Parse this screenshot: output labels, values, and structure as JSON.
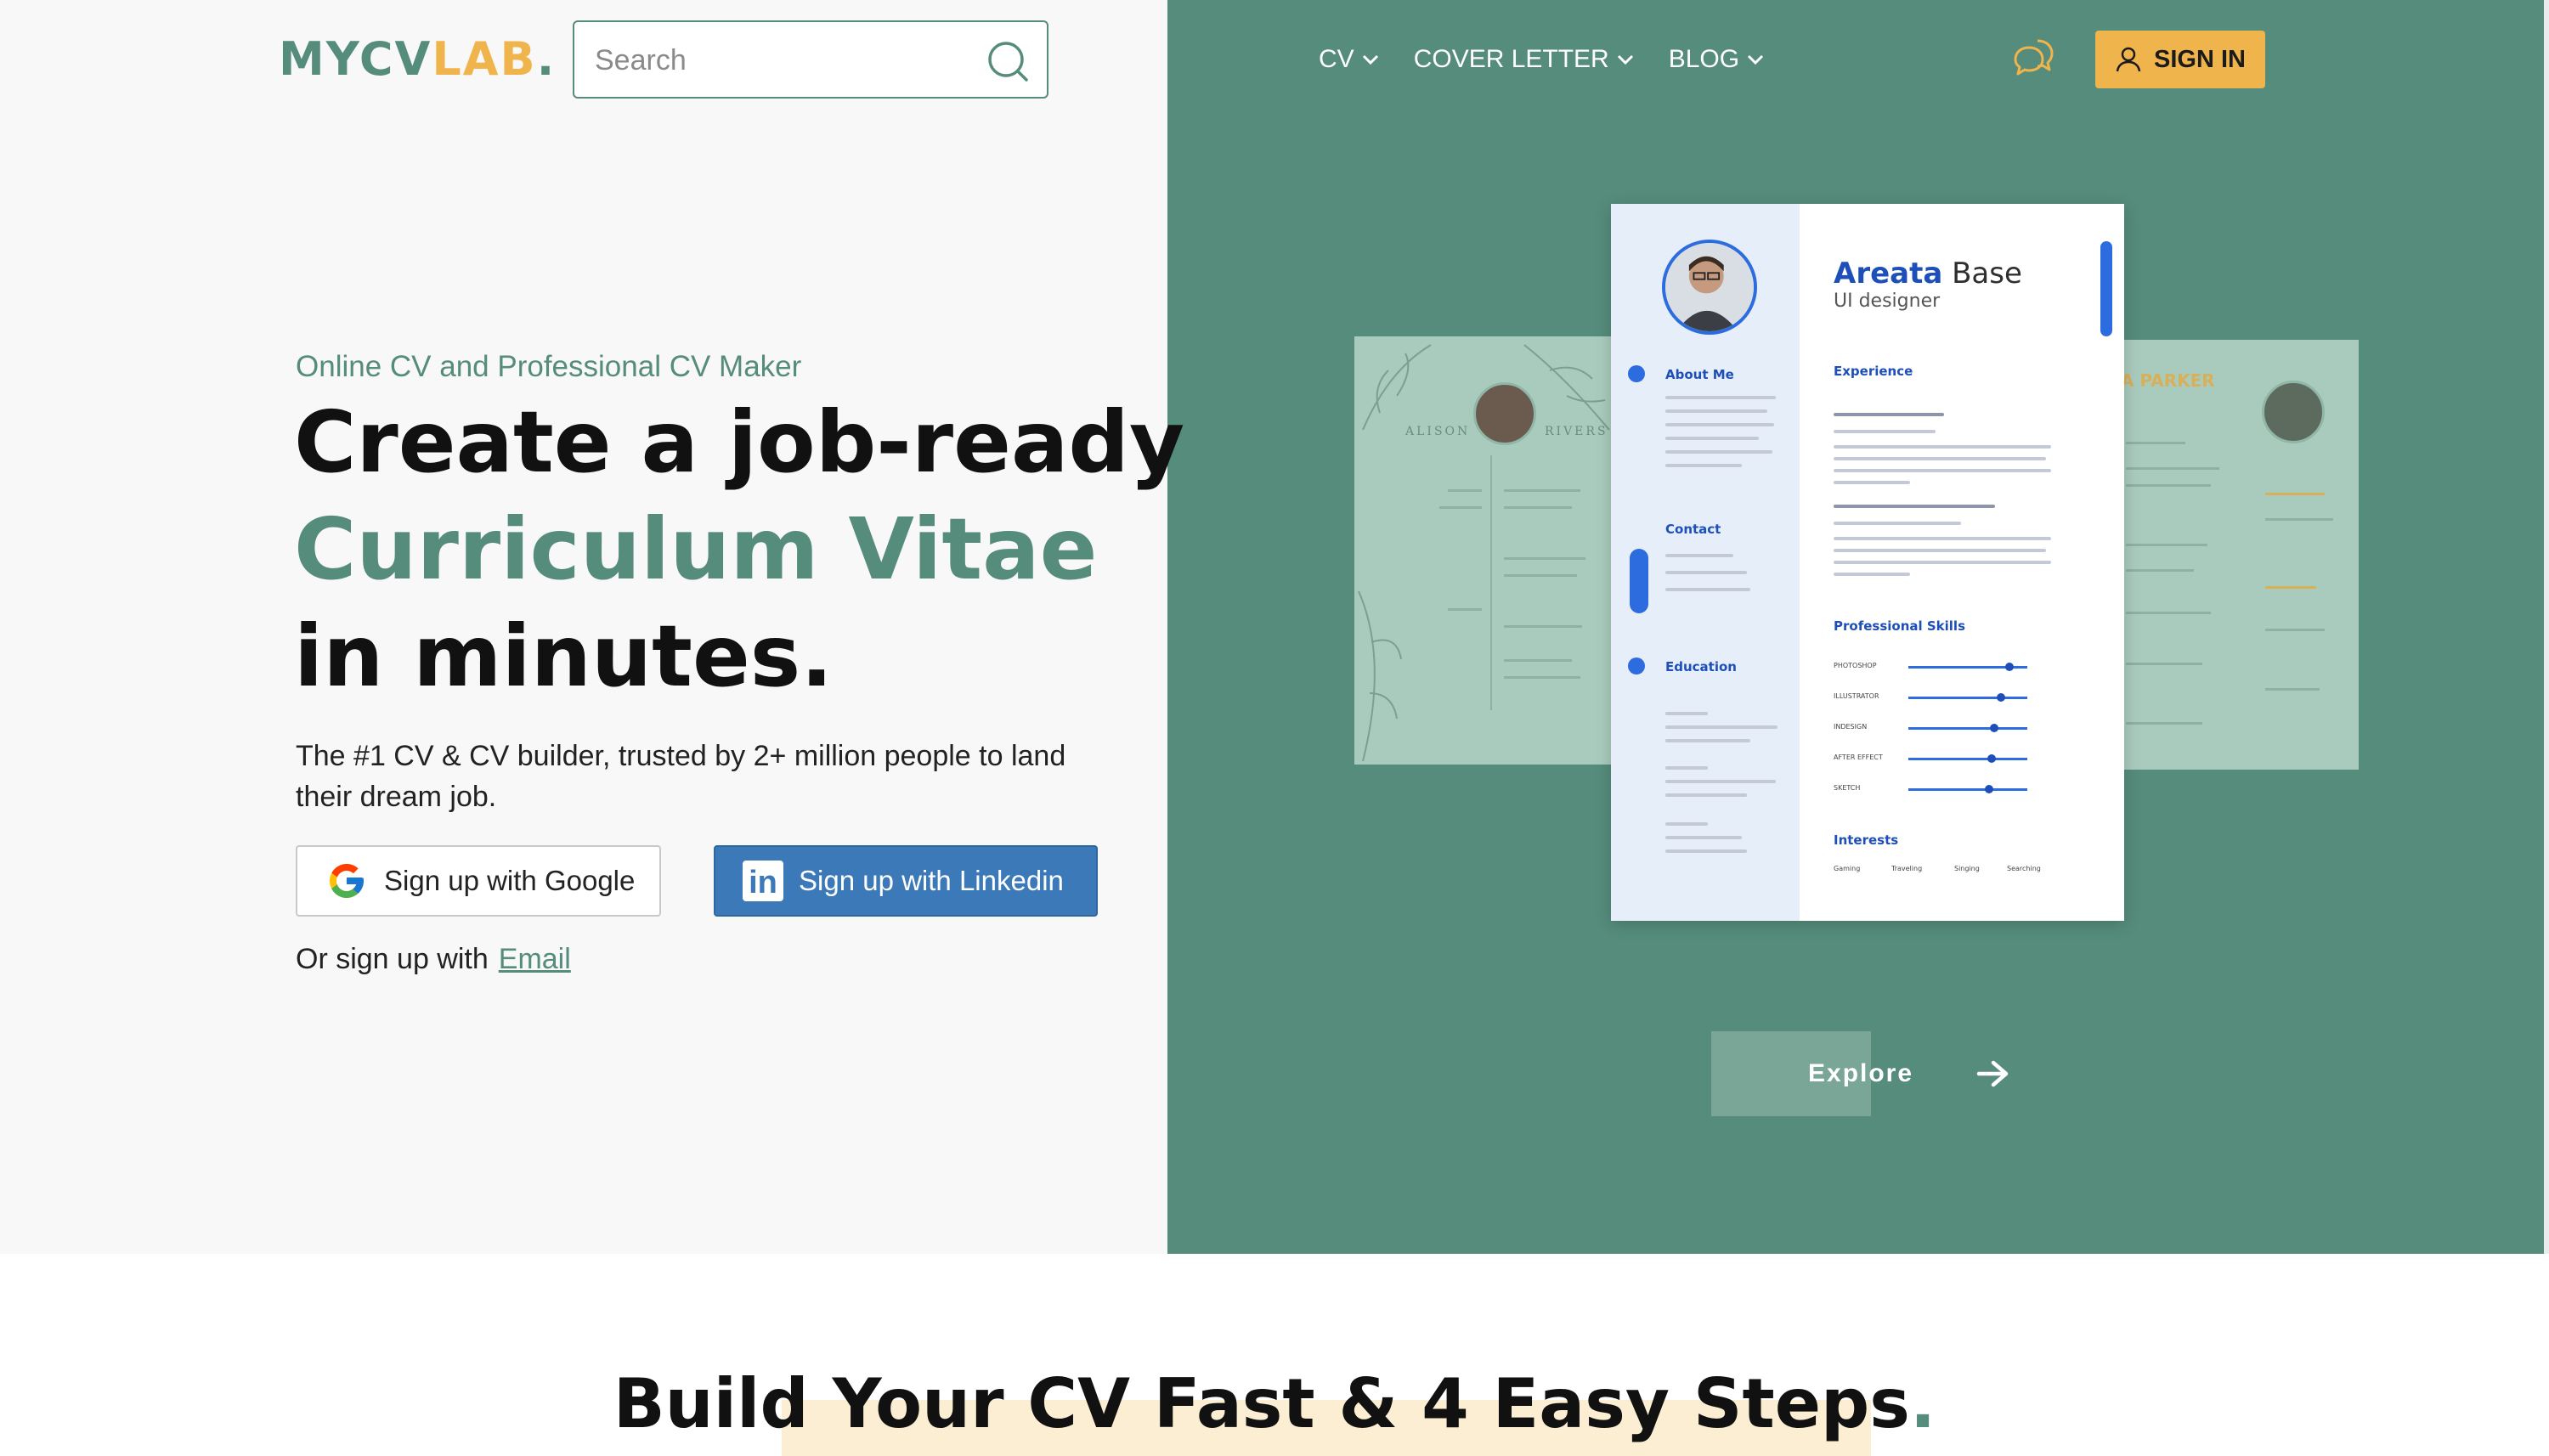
{
  "brand": {
    "logo_part1": "MYCV",
    "logo_part2": "LAB",
    "logo_part3": ".",
    "primary_color": "#558c7b",
    "accent_color": "#f0b44c"
  },
  "search": {
    "placeholder": "Search",
    "icon": "search-icon"
  },
  "nav": {
    "items": [
      {
        "label": "CV",
        "icon": "chevron-down-icon"
      },
      {
        "label": "COVER LETTER",
        "icon": "chevron-down-icon"
      },
      {
        "label": "BLOG",
        "icon": "chevron-down-icon"
      }
    ],
    "chat_icon": "chat-bubbles-icon",
    "signin_label": "SIGN IN",
    "signin_icon": "user-icon"
  },
  "hero": {
    "eyebrow": "Online CV and Professional CV Maker",
    "headline_line1": "Create a job-ready",
    "headline_line2": "Curriculum Vitae",
    "headline_line3": "in minutes.",
    "subtext": "The #1 CV & CV builder, trusted by 2+ million people to land their dream job.",
    "google_button": "Sign up with Google",
    "linkedin_button": "Sign up with Linkedin",
    "or_text": "Or sign up with",
    "email_link": "Email"
  },
  "resume_preview": {
    "name_first": "Areata",
    "name_last": "Base",
    "role": "UI designer",
    "sections": {
      "about": "About Me",
      "contact": "Contact",
      "education": "Education",
      "experience": "Experience",
      "skills": "Professional Skills",
      "interests": "Interests"
    },
    "skills": [
      {
        "name": "PHOTOSHOP",
        "level": 0.85
      },
      {
        "name": "ILLUSTRATOR",
        "level": 0.78
      },
      {
        "name": "INDESIGN",
        "level": 0.72
      },
      {
        "name": "AFTER EFFECT",
        "level": 0.7
      },
      {
        "name": "SKETCH",
        "level": 0.68
      }
    ],
    "interests": [
      "Gaming",
      "Traveling",
      "Singing",
      "Searching"
    ],
    "left_card_name_first": "ALISON",
    "left_card_name_last": "RIVERS",
    "right_card_name": "A PARKER"
  },
  "explore": {
    "label": "Explore",
    "icon": "arrow-right-icon"
  },
  "steps": {
    "title": "Build Your CV Fast & 4 Easy Steps",
    "title_dot": "."
  }
}
